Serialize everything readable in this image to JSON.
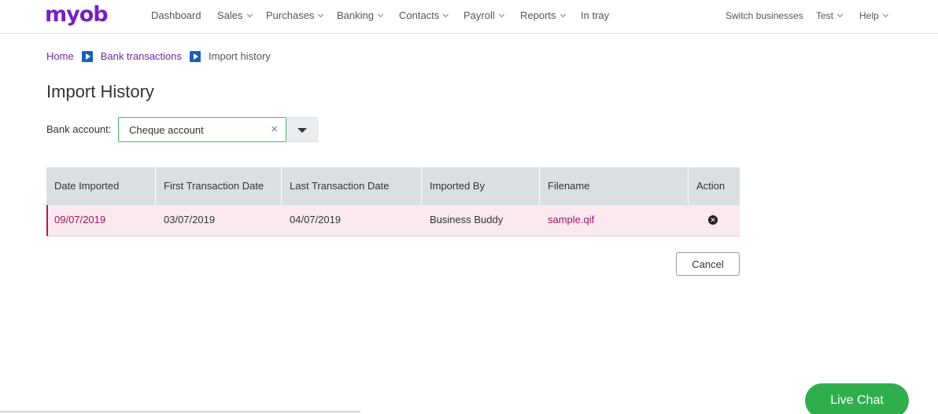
{
  "brand": {
    "logo_text": "myob",
    "logo_color": "#7a1fbf"
  },
  "nav": {
    "items": [
      {
        "label": "Dashboard",
        "has_caret": false
      },
      {
        "label": "Sales",
        "has_caret": true
      },
      {
        "label": "Purchases",
        "has_caret": true
      },
      {
        "label": "Banking",
        "has_caret": true
      },
      {
        "label": "Contacts",
        "has_caret": true
      },
      {
        "label": "Payroll",
        "has_caret": true
      },
      {
        "label": "Reports",
        "has_caret": true
      },
      {
        "label": "In tray",
        "has_caret": false
      }
    ],
    "right": [
      {
        "label": "Switch businesses",
        "has_caret": false
      },
      {
        "label": "Test",
        "has_caret": true
      },
      {
        "label": "Help",
        "has_caret": true
      }
    ]
  },
  "breadcrumb": {
    "home": "Home",
    "bank_transactions": "Bank transactions",
    "current": "Import history"
  },
  "page": {
    "title": "Import History"
  },
  "filter": {
    "bank_account_label": "Bank account:",
    "bank_account_value": "Cheque account",
    "clear_glyph": "×"
  },
  "table": {
    "columns": [
      "Date Imported",
      "First Transaction Date",
      "Last Transaction Date",
      "Imported By",
      "Filename",
      "Action"
    ],
    "rows": [
      {
        "date_imported": "09/07/2019",
        "first_transaction_date": "03/07/2019",
        "last_transaction_date": "04/07/2019",
        "imported_by": "Business Buddy",
        "filename": "sample.qif",
        "action_icon": "delete-icon"
      }
    ]
  },
  "actions": {
    "cancel_label": "Cancel"
  },
  "chat": {
    "label": "Live Chat",
    "color": "#2fae4e"
  },
  "colors": {
    "accent_purple": "#6b2aa0",
    "row_highlight": "#fbe9ef",
    "row_text_pink": "#9b1360"
  }
}
